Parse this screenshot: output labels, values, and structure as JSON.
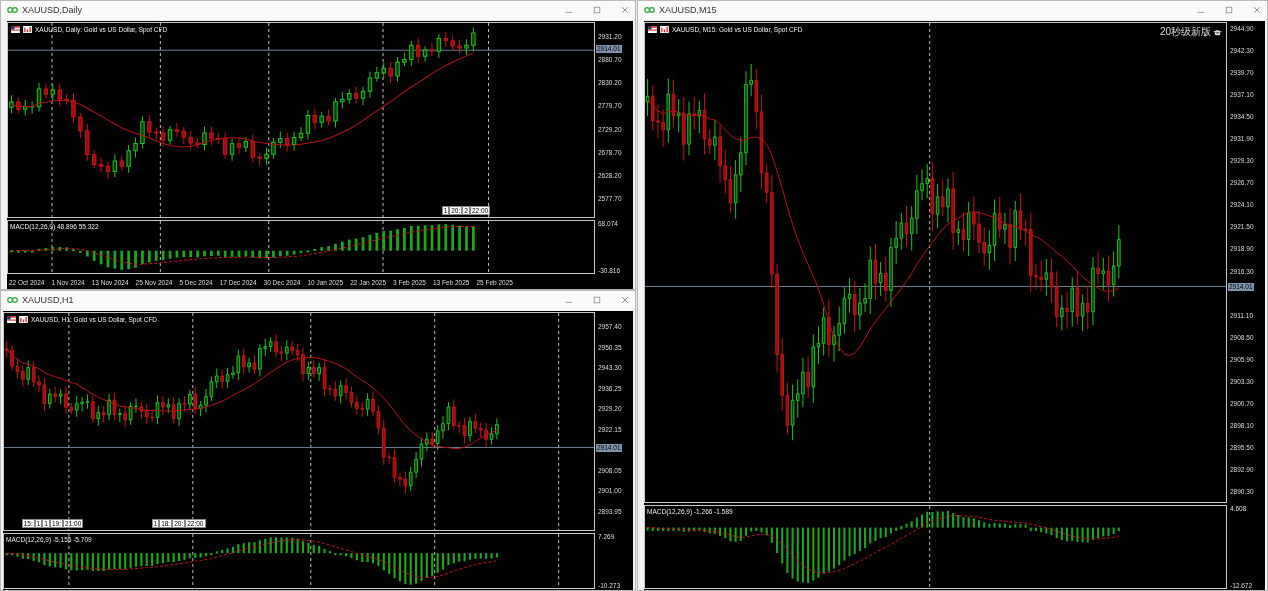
{
  "windows": [
    {
      "title": "XAUUSD,Daily",
      "chart_label": "XAUUSD, Daily:  Gold vs US Dollar, Spot CFD",
      "price_ticks": [
        "2931.20",
        "2880.70",
        "2830.20",
        "2779.70",
        "2729.20",
        "2678.70",
        "2628.20",
        "2577.70"
      ],
      "current_price": "2914.01",
      "period_tags": [
        {
          "parts": [
            "1",
            "20:",
            "2",
            "22:00"
          ]
        }
      ],
      "macd": {
        "label": "MACD(12,26,9) 48.896 55.322",
        "ticks": [
          "68.074",
          "-30.816"
        ]
      },
      "time_labels": [
        "22 Oct 2024",
        "1 Nov 2024",
        "13 Nov 2024",
        "25 Nov 2024",
        "5 Dec 2024",
        "17 Dec 2024",
        "30 Dec 2024",
        "10 Jan 2025",
        "22 Jan 2025",
        "3 Feb 2025",
        "13 Feb 2025",
        "25 Feb 2025"
      ]
    },
    {
      "title": "XAUUSD,H1",
      "chart_label": "XAUUSD, H1:  Gold vs US Dollar, Spot CFD",
      "price_ticks": [
        "2957.40",
        "2950.35",
        "2943.30",
        "2936.25",
        "2929.20",
        "2922.15",
        "2908.05",
        "2901.00",
        "2893.95"
      ],
      "current_price": "2914.01",
      "period_tags": [
        {
          "parts": [
            "15:",
            "1",
            "1",
            "19:",
            "21:00"
          ]
        },
        {
          "parts": [
            "1",
            "18:",
            "20:",
            "22:00"
          ]
        }
      ],
      "macd": {
        "label": "MACD(12,26,9) -5.155 -5.709",
        "ticks": [
          "7.269",
          "-10.273"
        ]
      }
    },
    {
      "title": "XAUUSD,M15",
      "chart_label": "XAUUSD, M15:  Gold vs US Dollar, Spot CFD",
      "badge": "20秒级新版",
      "price_ticks": [
        "2944.90",
        "2942.30",
        "2939.70",
        "2937.10",
        "2934.50",
        "2931.90",
        "2929.30",
        "2926.70",
        "2924.10",
        "2921.50",
        "2918.90",
        "2916.30",
        "2911.10",
        "2908.50",
        "2905.90",
        "2903.30",
        "2900.70",
        "2898.10",
        "2895.50",
        "2892.90",
        "2890.30"
      ],
      "current_price": "2914.01",
      "macd": {
        "label": "MACD(12,26,9) -1.266 -1.589",
        "ticks": [
          "4.608",
          "-12.672"
        ]
      }
    }
  ]
}
